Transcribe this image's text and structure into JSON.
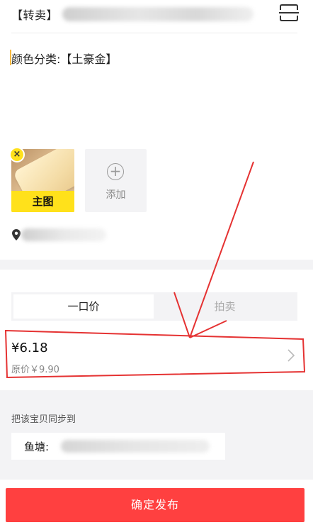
{
  "header": {
    "title_prefix": "【转卖】",
    "scan_icon": "scan-icon"
  },
  "description": {
    "text": "颜色分类:【土豪金】"
  },
  "images": {
    "main_label": "主图",
    "delete_mark": "×",
    "add_label": "添加",
    "add_icon": "plus-circle-icon"
  },
  "location": {
    "icon": "location-pin-icon"
  },
  "price_type": {
    "tabs": [
      "一口价",
      "拍卖"
    ],
    "selected": "一口价"
  },
  "price": {
    "current": "¥6.18",
    "original": "原价￥9.90"
  },
  "sync": {
    "title": "把该宝贝同步到",
    "fish_label": "鱼塘:"
  },
  "actions": {
    "submit_label": "确定发布"
  },
  "colors": {
    "accent_red": "#ff4040",
    "badge_yellow": "#ffe11b",
    "annotation_red": "#e53232",
    "background_gray": "#f3f3f5"
  }
}
